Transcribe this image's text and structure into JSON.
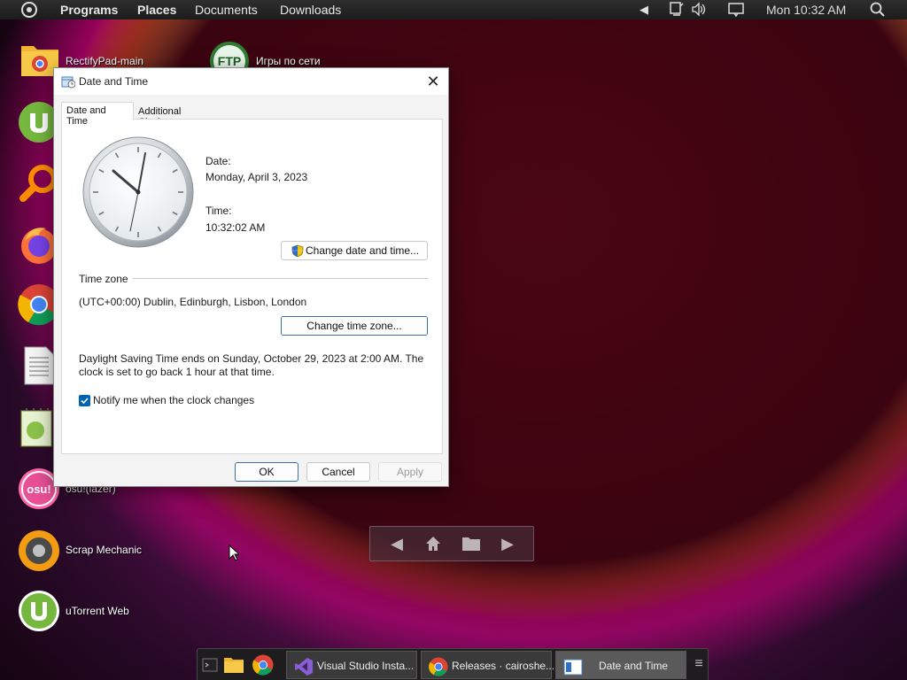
{
  "top_panel": {
    "menu": [
      "Programs",
      "Places",
      "Documents",
      "Downloads"
    ],
    "clock": "Mon 10:32 AM",
    "icons": [
      "menu-icon",
      "arrow-icon",
      "network-icon",
      "volume-icon",
      "notification-icon",
      "search-icon"
    ]
  },
  "desktop": {
    "icons": [
      {
        "label": "RectifyPad-main",
        "icon": "folder-chrome-icon"
      },
      {
        "label": "Игры по сети",
        "icon": "ftp-icon"
      },
      {
        "label": "",
        "icon": "utorrent-icon"
      },
      {
        "label": "",
        "icon": "search-magnifier-icon"
      },
      {
        "label": "",
        "icon": "firefox-icon"
      },
      {
        "label": "",
        "icon": "chrome-icon"
      },
      {
        "label": "",
        "icon": "document-icon"
      },
      {
        "label": "",
        "icon": "notepad-icon"
      },
      {
        "label": "osu!(lazer)",
        "icon": "osu-icon"
      },
      {
        "label": "Scrap Mechanic",
        "icon": "scrap-mechanic-icon"
      },
      {
        "label": "uTorrent Web",
        "icon": "utorrent-web-icon"
      }
    ]
  },
  "dialog": {
    "title": "Date and Time",
    "tabs": [
      "Date and Time",
      "Additional Clocks"
    ],
    "date_label": "Date:",
    "date_value": "Monday, April 3, 2023",
    "time_label": "Time:",
    "time_value": "10:32:02 AM",
    "change_datetime_button": "Change date and time...",
    "timezone_header": "Time zone",
    "timezone_value": "(UTC+00:00) Dublin, Edinburgh, Lisbon, London",
    "change_timezone_button": "Change time zone...",
    "dst_line1": "Daylight Saving Time ends on Sunday, October 29, 2023 at 2:00 AM. The",
    "dst_line2": "clock is set to go back 1 hour at that time.",
    "notify_label": "Notify me when the clock changes",
    "notify_checked": true,
    "ok": "OK",
    "cancel": "Cancel",
    "apply": "Apply"
  },
  "taskbar": {
    "tasks": [
      {
        "label": "Visual Studio Insta...",
        "icon": "visual-studio-icon"
      },
      {
        "label": "Releases · cairoshe...",
        "icon": "chrome-icon"
      },
      {
        "label": "Date and Time",
        "icon": "date-time-app-icon"
      }
    ]
  },
  "colors": {
    "accent": "#0063b1",
    "dialog_bg": "#f3f3f3",
    "panel_bg": "#1c1c1c"
  }
}
